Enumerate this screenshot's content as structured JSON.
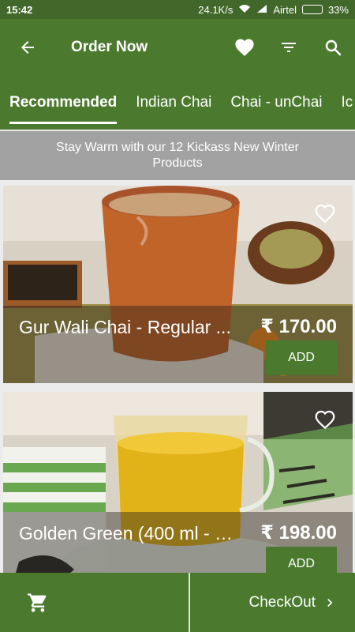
{
  "status_bar": {
    "time": "15:42",
    "network_speed": "24.1K/s",
    "carrier": "Airtel",
    "battery": "33%",
    "battery_level": 0.33
  },
  "app_bar": {
    "title": "Order Now",
    "icons": [
      "arrow-back-icon",
      "heart-icon",
      "filter-icon",
      "search-icon"
    ]
  },
  "tabs": [
    {
      "label": "Recommended",
      "active": true
    },
    {
      "label": "Indian Chai",
      "active": false
    },
    {
      "label": "Chai - unChai",
      "active": false
    },
    {
      "label": "Ic",
      "active": false
    }
  ],
  "banner": {
    "text": "Stay Warm with our 12 Kickass New Winter Products"
  },
  "products": [
    {
      "name": "Gur Wali Chai - Regular ...",
      "price": "₹ 170.00",
      "add_label": "ADD"
    },
    {
      "name": "Golden Green (400 ml - s...",
      "price": "₹ 198.00",
      "add_label": "ADD"
    }
  ],
  "bottom_bar": {
    "checkout_label": "CheckOut"
  },
  "colors": {
    "primary_green": "#4b7a2f",
    "status_green": "#41682a",
    "banner_gray": "#a2a2a2"
  }
}
